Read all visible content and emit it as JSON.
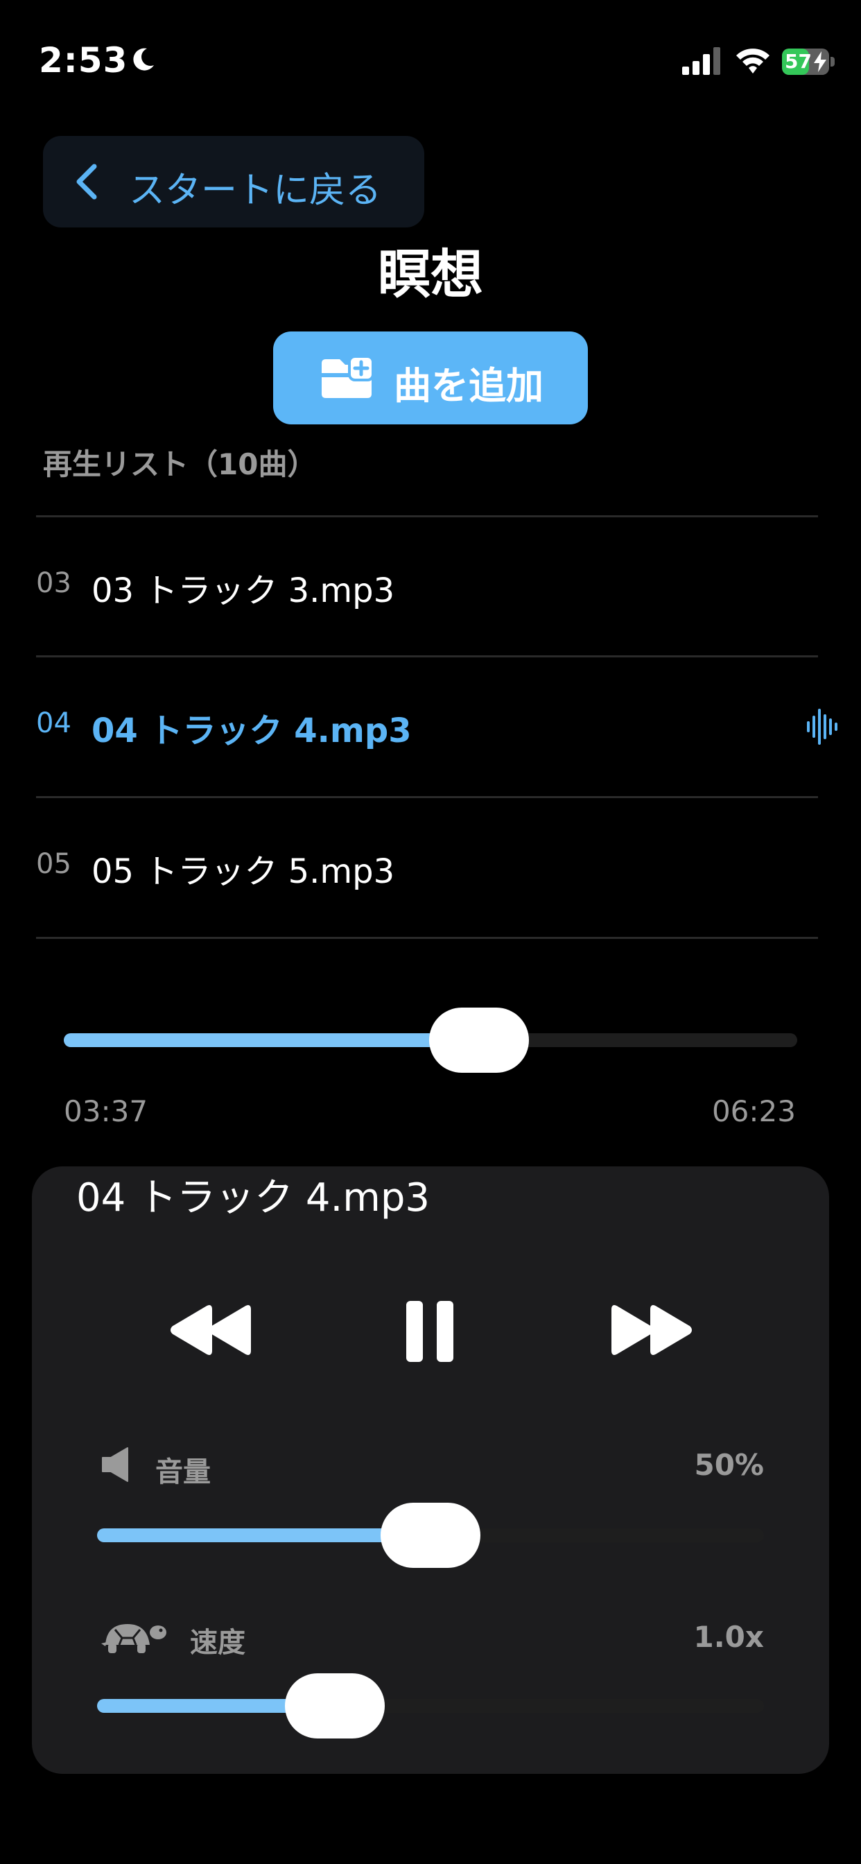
{
  "status_bar": {
    "time": "2:53",
    "battery_percent": "57",
    "battery_level": 57
  },
  "nav": {
    "back_label": "スタートに戻る"
  },
  "page": {
    "title": "瞑想"
  },
  "actions": {
    "add_label": "曲を追加"
  },
  "playlist": {
    "header": "再生リスト（10曲）",
    "items": [
      {
        "num": "03",
        "name": "03 トラック 3.mp3",
        "active": false
      },
      {
        "num": "04",
        "name": "04 トラック 4.mp3",
        "active": true
      },
      {
        "num": "05",
        "name": "05 トラック 5.mp3",
        "active": false
      }
    ]
  },
  "progress": {
    "current": "03:37",
    "total": "06:23",
    "fraction": 0.566
  },
  "player": {
    "now_playing": "04 トラック 4.mp3",
    "volume": {
      "label": "音量",
      "value": "50%",
      "fraction": 0.5
    },
    "speed": {
      "label": "速度",
      "value": "1.0x",
      "fraction": 0.357
    }
  },
  "colors": {
    "accent": "#5cb6f7",
    "background": "#000000",
    "card": "#1c1c1e",
    "battery": "#34c759"
  },
  "icons": [
    "moon-icon",
    "signal-icon",
    "wifi-icon",
    "battery-icon",
    "chevron-left-icon",
    "folder-add-icon",
    "waveform-icon",
    "rewind-icon",
    "pause-icon",
    "fast-forward-icon",
    "speaker-icon",
    "turtle-icon"
  ]
}
